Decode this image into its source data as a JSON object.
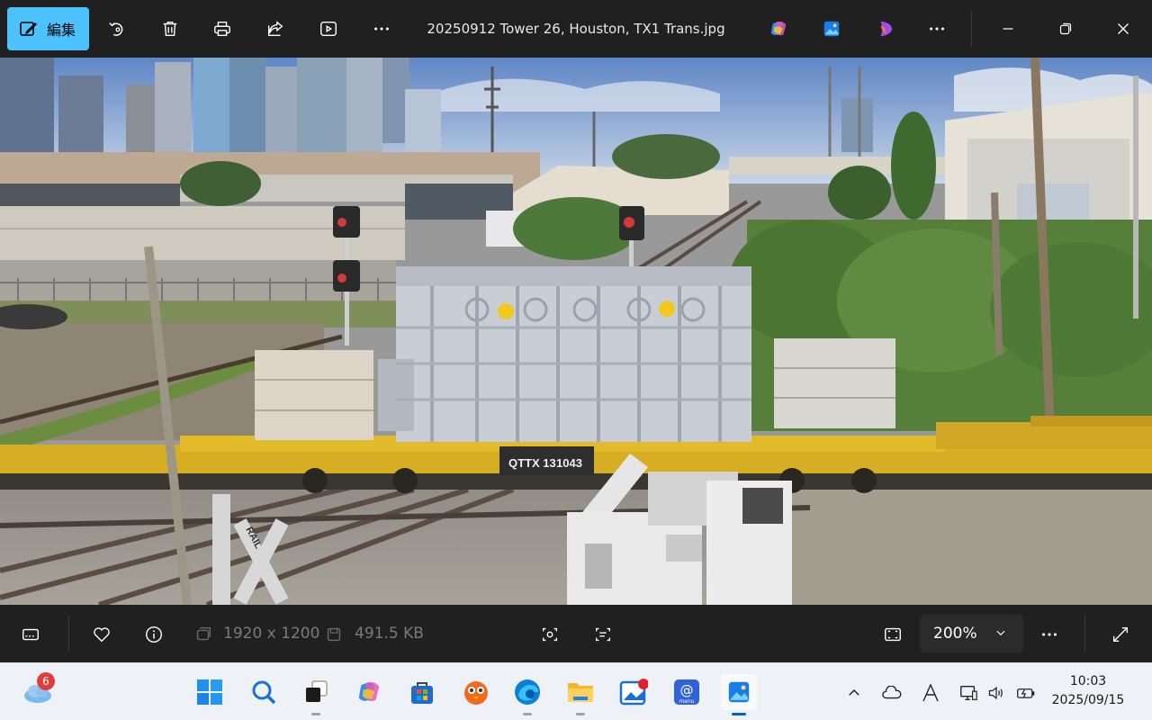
{
  "toolbar": {
    "edit_label": "編集",
    "title": "20250912 Tower 26, Houston, TX1 Trans.jpg",
    "icons": [
      "edit-icon",
      "rotate-icon",
      "delete-icon",
      "print-icon",
      "share-icon",
      "slideshow-icon",
      "more-icon",
      "copilot-icon",
      "photos-app-icon",
      "designer-icon",
      "more-icon",
      "minimize-icon",
      "restore-icon",
      "close-icon"
    ]
  },
  "photo": {
    "railcar_label": "QTTX 13",
    "railcar_number": "1043",
    "sign_text": "RAILROAD CROSSING"
  },
  "infobar": {
    "dimensions": "1920 x 1200",
    "file_size": "491.5 KB",
    "zoom": "200%"
  },
  "taskbar": {
    "weather_badge": "6",
    "apps": [
      "start",
      "search",
      "task-view",
      "copilot",
      "store",
      "duolingo",
      "edge",
      "file-explorer",
      "photo-editor",
      "mail",
      "photos"
    ],
    "time": "10:03",
    "date": "2025/09/15",
    "tray": [
      "chevron-up-icon",
      "onedrive-icon",
      "ime-icon",
      "network-icon",
      "volume-icon",
      "battery-icon"
    ]
  },
  "colors": {
    "accent": "#4cc2ff",
    "toolbar_bg": "#202020",
    "taskbar_bg": "#eef1f6",
    "railcar_yellow": "#e0b420",
    "transformer_gray": "#c8cdd6"
  }
}
